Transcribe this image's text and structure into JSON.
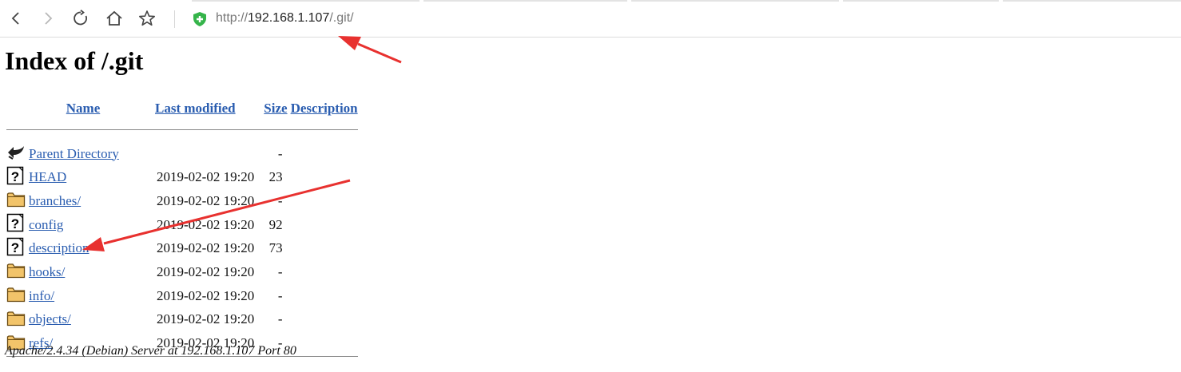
{
  "browser": {
    "url_scheme": "http://",
    "url_host": "192.168.1.107",
    "url_path": "/.git/"
  },
  "page": {
    "title": "Index of /.git"
  },
  "table": {
    "headers": {
      "name": "Name",
      "last_modified": "Last modified",
      "size": "Size",
      "description": "Description"
    },
    "rows": [
      {
        "icon": "back-arrow-icon",
        "name": "Parent Directory",
        "date": "",
        "size": "-",
        "description": ""
      },
      {
        "icon": "unknown-file-icon",
        "name": "HEAD",
        "date": "2019-02-02 19:20",
        "size": "23",
        "description": ""
      },
      {
        "icon": "folder-icon",
        "name": "branches/",
        "date": "2019-02-02 19:20",
        "size": "-",
        "description": ""
      },
      {
        "icon": "unknown-file-icon",
        "name": "config",
        "date": "2019-02-02 19:20",
        "size": "92",
        "description": ""
      },
      {
        "icon": "unknown-file-icon",
        "name": "description",
        "date": "2019-02-02 19:20",
        "size": "73",
        "description": ""
      },
      {
        "icon": "folder-icon",
        "name": "hooks/",
        "date": "2019-02-02 19:20",
        "size": "-",
        "description": ""
      },
      {
        "icon": "folder-icon",
        "name": "info/",
        "date": "2019-02-02 19:20",
        "size": "-",
        "description": ""
      },
      {
        "icon": "folder-icon",
        "name": "objects/",
        "date": "2019-02-02 19:20",
        "size": "-",
        "description": ""
      },
      {
        "icon": "folder-icon",
        "name": "refs/",
        "date": "2019-02-02 19:20",
        "size": "-",
        "description": ""
      }
    ]
  },
  "footer": {
    "text": "Apache/2.4.34 (Debian) Server at 192.168.1.107 Port 80"
  },
  "colors": {
    "link": "#2a5db0",
    "annotation_arrow": "#e8312f",
    "shield": "#35b44a"
  }
}
